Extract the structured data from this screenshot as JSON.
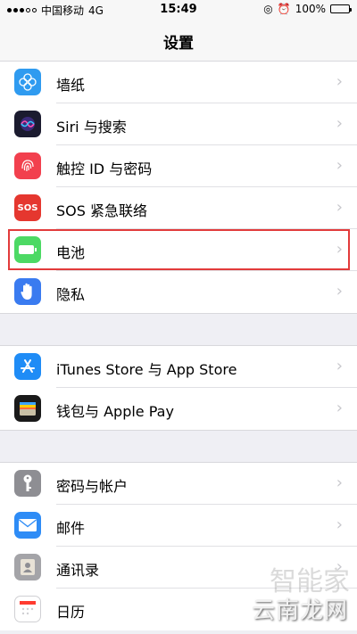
{
  "status_bar": {
    "carrier": "中国移动",
    "network": "4G",
    "time": "15:49",
    "battery": "100%"
  },
  "nav": {
    "title": "设置"
  },
  "groups": [
    {
      "items": [
        {
          "label": "墙纸",
          "icon": "wallpaper-icon",
          "color": "#2f9bf0"
        },
        {
          "label": "Siri 与搜索",
          "icon": "siri-icon",
          "color": "#1b1b2f"
        },
        {
          "label": "触控 ID 与密码",
          "icon": "fingerprint-icon",
          "color": "#f2404e"
        },
        {
          "label": "SOS 紧急联络",
          "icon": "sos-icon",
          "color": "#e5372f",
          "icon_text": "SOS"
        },
        {
          "label": "电池",
          "icon": "battery-icon",
          "color": "#4cd964"
        },
        {
          "label": "隐私",
          "icon": "hand-icon",
          "color": "#3a7bf0"
        }
      ]
    },
    {
      "items": [
        {
          "label": "iTunes Store 与 App Store",
          "icon": "app-store-icon",
          "color": "#1f8cf6"
        },
        {
          "label": "钱包与 Apple Pay",
          "icon": "wallet-icon",
          "color": "#1a1a1a"
        }
      ]
    },
    {
      "items": [
        {
          "label": "密码与帐户",
          "icon": "key-icon",
          "color": "#8e8e93"
        },
        {
          "label": "邮件",
          "icon": "mail-icon",
          "color": "#2e8cf6"
        },
        {
          "label": "通讯录",
          "icon": "contacts-icon",
          "color": "#a4a4a8"
        },
        {
          "label": "日历",
          "icon": "calendar-icon",
          "color": "#ffffff"
        }
      ]
    }
  ],
  "watermark": {
    "top": "智能家",
    "bottom": "云南龙网"
  }
}
